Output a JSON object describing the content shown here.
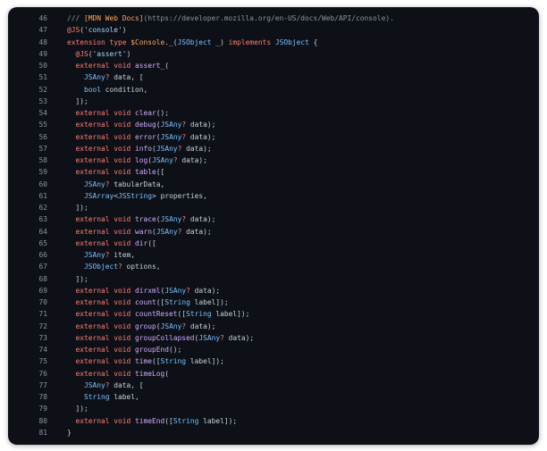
{
  "code": {
    "lines": [
      {
        "n": "46",
        "t": [
          [
            "comment",
            "/// "
          ],
          [
            "link",
            "[MDN Web Docs]"
          ],
          [
            "comment",
            "(https://developer.mozilla.org/en-US/docs/Web/API/console)."
          ]
        ]
      },
      {
        "n": "47",
        "t": [
          [
            "keyword",
            "@JS"
          ],
          [
            "plain",
            "("
          ],
          [
            "string",
            "'console'"
          ],
          [
            "plain",
            ")"
          ]
        ]
      },
      {
        "n": "48",
        "t": [
          [
            "keyword",
            "extension type "
          ],
          [
            "name",
            "$Console"
          ],
          [
            "plain",
            "._("
          ],
          [
            "type",
            "JSObject"
          ],
          [
            "plain",
            " _) "
          ],
          [
            "keyword",
            "implements"
          ],
          [
            "plain",
            " "
          ],
          [
            "type",
            "JSObject"
          ],
          [
            "plain",
            " {"
          ]
        ]
      },
      {
        "n": "49",
        "t": [
          [
            "plain",
            "  "
          ],
          [
            "keyword",
            "@JS"
          ],
          [
            "plain",
            "("
          ],
          [
            "string",
            "'assert'"
          ],
          [
            "plain",
            ")"
          ]
        ]
      },
      {
        "n": "50",
        "t": [
          [
            "plain",
            "  "
          ],
          [
            "keyword",
            "external void "
          ],
          [
            "func",
            "assert_"
          ],
          [
            "plain",
            "("
          ]
        ]
      },
      {
        "n": "51",
        "t": [
          [
            "plain",
            "    "
          ],
          [
            "type",
            "JSAny"
          ],
          [
            "keyword",
            "?"
          ],
          [
            "plain",
            " data, ["
          ]
        ]
      },
      {
        "n": "52",
        "t": [
          [
            "plain",
            "    "
          ],
          [
            "type",
            "bool"
          ],
          [
            "plain",
            " condition,"
          ]
        ]
      },
      {
        "n": "53",
        "t": [
          [
            "plain",
            "  ]);"
          ]
        ]
      },
      {
        "n": "54",
        "t": [
          [
            "plain",
            "  "
          ],
          [
            "keyword",
            "external void "
          ],
          [
            "func",
            "clear"
          ],
          [
            "plain",
            "();"
          ]
        ]
      },
      {
        "n": "55",
        "t": [
          [
            "plain",
            "  "
          ],
          [
            "keyword",
            "external void "
          ],
          [
            "func",
            "debug"
          ],
          [
            "plain",
            "("
          ],
          [
            "type",
            "JSAny"
          ],
          [
            "keyword",
            "?"
          ],
          [
            "plain",
            " data);"
          ]
        ]
      },
      {
        "n": "56",
        "t": [
          [
            "plain",
            "  "
          ],
          [
            "keyword",
            "external void "
          ],
          [
            "func",
            "error"
          ],
          [
            "plain",
            "("
          ],
          [
            "type",
            "JSAny"
          ],
          [
            "keyword",
            "?"
          ],
          [
            "plain",
            " data);"
          ]
        ]
      },
      {
        "n": "57",
        "t": [
          [
            "plain",
            "  "
          ],
          [
            "keyword",
            "external void "
          ],
          [
            "func",
            "info"
          ],
          [
            "plain",
            "("
          ],
          [
            "type",
            "JSAny"
          ],
          [
            "keyword",
            "?"
          ],
          [
            "plain",
            " data);"
          ]
        ]
      },
      {
        "n": "58",
        "t": [
          [
            "plain",
            "  "
          ],
          [
            "keyword",
            "external void "
          ],
          [
            "func",
            "log"
          ],
          [
            "plain",
            "("
          ],
          [
            "type",
            "JSAny"
          ],
          [
            "keyword",
            "?"
          ],
          [
            "plain",
            " data);"
          ]
        ]
      },
      {
        "n": "59",
        "t": [
          [
            "plain",
            "  "
          ],
          [
            "keyword",
            "external void "
          ],
          [
            "func",
            "table"
          ],
          [
            "plain",
            "(["
          ]
        ]
      },
      {
        "n": "60",
        "t": [
          [
            "plain",
            "    "
          ],
          [
            "type",
            "JSAny"
          ],
          [
            "keyword",
            "?"
          ],
          [
            "plain",
            " tabularData,"
          ]
        ]
      },
      {
        "n": "61",
        "t": [
          [
            "plain",
            "    "
          ],
          [
            "type",
            "JSArray"
          ],
          [
            "plain",
            "<"
          ],
          [
            "type",
            "JSString"
          ],
          [
            "plain",
            "> properties,"
          ]
        ]
      },
      {
        "n": "62",
        "t": [
          [
            "plain",
            "  ]);"
          ]
        ]
      },
      {
        "n": "63",
        "t": [
          [
            "plain",
            "  "
          ],
          [
            "keyword",
            "external void "
          ],
          [
            "func",
            "trace"
          ],
          [
            "plain",
            "("
          ],
          [
            "type",
            "JSAny"
          ],
          [
            "keyword",
            "?"
          ],
          [
            "plain",
            " data);"
          ]
        ]
      },
      {
        "n": "64",
        "t": [
          [
            "plain",
            "  "
          ],
          [
            "keyword",
            "external void "
          ],
          [
            "func",
            "warn"
          ],
          [
            "plain",
            "("
          ],
          [
            "type",
            "JSAny"
          ],
          [
            "keyword",
            "?"
          ],
          [
            "plain",
            " data);"
          ]
        ]
      },
      {
        "n": "65",
        "t": [
          [
            "plain",
            "  "
          ],
          [
            "keyword",
            "external void "
          ],
          [
            "func",
            "dir"
          ],
          [
            "plain",
            "(["
          ]
        ]
      },
      {
        "n": "66",
        "t": [
          [
            "plain",
            "    "
          ],
          [
            "type",
            "JSAny"
          ],
          [
            "keyword",
            "?"
          ],
          [
            "plain",
            " item,"
          ]
        ]
      },
      {
        "n": "67",
        "t": [
          [
            "plain",
            "    "
          ],
          [
            "type",
            "JSObject"
          ],
          [
            "keyword",
            "?"
          ],
          [
            "plain",
            " options,"
          ]
        ]
      },
      {
        "n": "68",
        "t": [
          [
            "plain",
            "  ]);"
          ]
        ]
      },
      {
        "n": "69",
        "t": [
          [
            "plain",
            "  "
          ],
          [
            "keyword",
            "external void "
          ],
          [
            "func",
            "dirxml"
          ],
          [
            "plain",
            "("
          ],
          [
            "type",
            "JSAny"
          ],
          [
            "keyword",
            "?"
          ],
          [
            "plain",
            " data);"
          ]
        ]
      },
      {
        "n": "70",
        "t": [
          [
            "plain",
            "  "
          ],
          [
            "keyword",
            "external void "
          ],
          [
            "func",
            "count"
          ],
          [
            "plain",
            "(["
          ],
          [
            "type",
            "String"
          ],
          [
            "plain",
            " label]);"
          ]
        ]
      },
      {
        "n": "71",
        "t": [
          [
            "plain",
            "  "
          ],
          [
            "keyword",
            "external void "
          ],
          [
            "func",
            "countReset"
          ],
          [
            "plain",
            "(["
          ],
          [
            "type",
            "String"
          ],
          [
            "plain",
            " label]);"
          ]
        ]
      },
      {
        "n": "72",
        "t": [
          [
            "plain",
            "  "
          ],
          [
            "keyword",
            "external void "
          ],
          [
            "func",
            "group"
          ],
          [
            "plain",
            "("
          ],
          [
            "type",
            "JSAny"
          ],
          [
            "keyword",
            "?"
          ],
          [
            "plain",
            " data);"
          ]
        ]
      },
      {
        "n": "73",
        "t": [
          [
            "plain",
            "  "
          ],
          [
            "keyword",
            "external void "
          ],
          [
            "func",
            "groupCollapsed"
          ],
          [
            "plain",
            "("
          ],
          [
            "type",
            "JSAny"
          ],
          [
            "keyword",
            "?"
          ],
          [
            "plain",
            " data);"
          ]
        ]
      },
      {
        "n": "74",
        "t": [
          [
            "plain",
            "  "
          ],
          [
            "keyword",
            "external void "
          ],
          [
            "func",
            "groupEnd"
          ],
          [
            "plain",
            "();"
          ]
        ]
      },
      {
        "n": "75",
        "t": [
          [
            "plain",
            "  "
          ],
          [
            "keyword",
            "external void "
          ],
          [
            "func",
            "time"
          ],
          [
            "plain",
            "(["
          ],
          [
            "type",
            "String"
          ],
          [
            "plain",
            " label]);"
          ]
        ]
      },
      {
        "n": "76",
        "t": [
          [
            "plain",
            "  "
          ],
          [
            "keyword",
            "external void "
          ],
          [
            "func",
            "timeLog"
          ],
          [
            "plain",
            "("
          ]
        ]
      },
      {
        "n": "77",
        "t": [
          [
            "plain",
            "    "
          ],
          [
            "type",
            "JSAny"
          ],
          [
            "keyword",
            "?"
          ],
          [
            "plain",
            " data, ["
          ]
        ]
      },
      {
        "n": "78",
        "t": [
          [
            "plain",
            "    "
          ],
          [
            "type",
            "String"
          ],
          [
            "plain",
            " label,"
          ]
        ]
      },
      {
        "n": "79",
        "t": [
          [
            "plain",
            "  ]);"
          ]
        ]
      },
      {
        "n": "80",
        "t": [
          [
            "plain",
            "  "
          ],
          [
            "keyword",
            "external void "
          ],
          [
            "func",
            "timeEnd"
          ],
          [
            "plain",
            "(["
          ],
          [
            "type",
            "String"
          ],
          [
            "plain",
            " label]);"
          ]
        ]
      },
      {
        "n": "81",
        "t": [
          [
            "plain",
            "}"
          ]
        ]
      }
    ]
  }
}
